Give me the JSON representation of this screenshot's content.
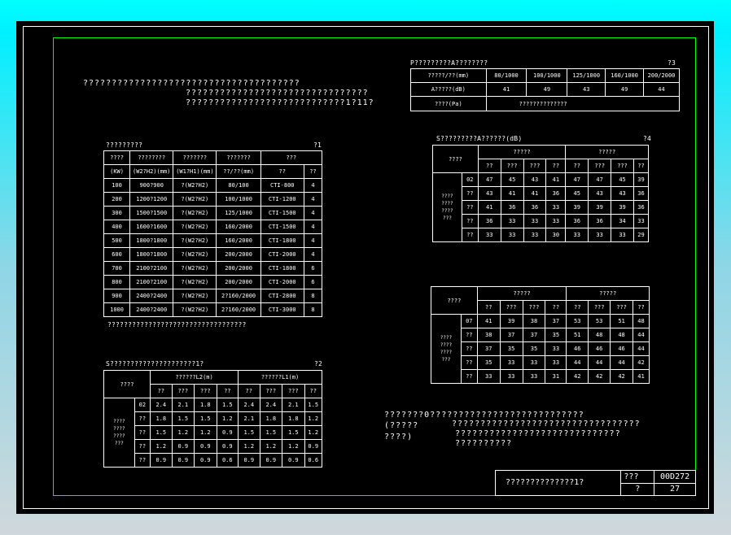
{
  "intro_lines": [
    "??????????????????????????????????????",
    "????????????????????????????????",
    "????????????????????????????1?11?"
  ],
  "table1": {
    "title": "?????????",
    "number": "?1",
    "header_top": [
      "????",
      "????????",
      "???????",
      "???????",
      "???"
    ],
    "header_bottom": [
      "(KW)",
      "(W2?H2)(mm)",
      "(W1?H1)(mm)",
      "??/??(mm)",
      "??",
      "??"
    ],
    "rows": [
      [
        "100",
        "900?900",
        "?(W2?H2)",
        "80/100",
        "CTI-800",
        "4"
      ],
      [
        "200",
        "1200?1200",
        "?(W2?H2)",
        "100/1000",
        "CTI-1200",
        "4"
      ],
      [
        "300",
        "1500?1500",
        "?(W2?H2)",
        "125/1000",
        "CTI-1500",
        "4"
      ],
      [
        "400",
        "1600?1600",
        "?(W2?H2)",
        "160/2000",
        "CTI-1500",
        "4"
      ],
      [
        "500",
        "1800?1800",
        "?(W2?H2)",
        "160/2000",
        "CTI-1800",
        "4"
      ],
      [
        "600",
        "1800?1800",
        "?(W2?H2)",
        "200/2000",
        "CTI-2000",
        "4"
      ],
      [
        "700",
        "2100?2100",
        "?(W2?H2)",
        "200/2000",
        "CTI-1800",
        "6"
      ],
      [
        "800",
        "2100?2100",
        "?(W2?H2)",
        "200/2000",
        "CTI-2000",
        "6"
      ],
      [
        "900",
        "2400?2400",
        "?(W2?H2)",
        "2?160/2000",
        "CTI-2800",
        "8"
      ],
      [
        "1000",
        "2400?2400",
        "?(W2?H2)",
        "2?160/2000",
        "CTI-3000",
        "8"
      ]
    ],
    "note": "??????????????????????????????????"
  },
  "table2": {
    "title": "S?????????????????????1?",
    "number": "?2",
    "corner": "????",
    "group1": "??????L2(m)",
    "group2": "??????L1(m)",
    "sub": [
      "??",
      "???",
      "???",
      "??",
      "??",
      "???",
      "???",
      "??"
    ],
    "side": "????\n????\n????\n???",
    "rows": [
      [
        "02",
        "2.4",
        "2.1",
        "1.8",
        "1.5",
        "2.4",
        "2.4",
        "2.1",
        "1.5"
      ],
      [
        "??",
        "1.8",
        "1.5",
        "1.5",
        "1.2",
        "2.1",
        "1.8",
        "1.8",
        "1.2"
      ],
      [
        "??",
        "1.5",
        "1.2",
        "1.2",
        "0.9",
        "1.5",
        "1.5",
        "1.5",
        "1.2"
      ],
      [
        "??",
        "1.2",
        "0.9",
        "0.9",
        "0.9",
        "1.2",
        "1.2",
        "1.2",
        "0.9"
      ],
      [
        "??",
        "0.9",
        "0.9",
        "0.9",
        "0.6",
        "0.9",
        "0.9",
        "0.9",
        "0.6"
      ]
    ]
  },
  "table3": {
    "title": "P?????????A????????",
    "number": "?3",
    "rows": [
      [
        "?????/??(mm)",
        "80/1000",
        "100/1000",
        "125/1000",
        "160/1000",
        "200/2000"
      ],
      [
        "A?????(dB)",
        "41",
        "49",
        "43",
        "49",
        "44"
      ]
    ],
    "pressure_label": "????(Pa)",
    "pressure_value": "??????????????"
  },
  "table4": {
    "title": "S?????????A??????(dB)",
    "number": "?4",
    "corner": "????",
    "group1": "?????",
    "group2": "?????",
    "sub": [
      "??",
      "???",
      "???",
      "??",
      "??",
      "???",
      "???",
      "??"
    ],
    "side": "????\n????\n????\n???",
    "rows": [
      [
        "02",
        "47",
        "45",
        "43",
        "41",
        "47",
        "47",
        "45",
        "39"
      ],
      [
        "??",
        "43",
        "41",
        "41",
        "36",
        "45",
        "43",
        "43",
        "36"
      ],
      [
        "??",
        "41",
        "36",
        "36",
        "33",
        "39",
        "39",
        "39",
        "36"
      ],
      [
        "??",
        "36",
        "33",
        "33",
        "33",
        "36",
        "36",
        "34",
        "33"
      ],
      [
        "??",
        "33",
        "33",
        "33",
        "30",
        "33",
        "33",
        "33",
        "29"
      ]
    ]
  },
  "table5": {
    "corner": "????",
    "group1": "?????",
    "group2": "?????",
    "sub": [
      "??",
      "???",
      "???",
      "??",
      "??",
      "???",
      "???",
      "??"
    ],
    "side": "????\n????\n????\n???",
    "rows": [
      [
        "07",
        "41",
        "39",
        "38",
        "37",
        "53",
        "53",
        "51",
        "48"
      ],
      [
        "??",
        "38",
        "37",
        "37",
        "35",
        "51",
        "48",
        "48",
        "44"
      ],
      [
        "??",
        "37",
        "35",
        "35",
        "33",
        "46",
        "46",
        "46",
        "44"
      ],
      [
        "??",
        "35",
        "33",
        "33",
        "33",
        "44",
        "44",
        "44",
        "42"
      ],
      [
        "??",
        "33",
        "33",
        "33",
        "31",
        "42",
        "42",
        "42",
        "41"
      ]
    ]
  },
  "bottom_note": {
    "line1": "???????0???????????????????????????",
    "line2_left": "(?????",
    "line2_right": "?????????????????????????????????",
    "line3_left": "????)",
    "line3_right": "?????????????????????????????",
    "line4": "??????????"
  },
  "title_block": {
    "title": "??????????????1?",
    "label1": "???",
    "value1": "00D272",
    "label2": "?",
    "value2": "27"
  }
}
